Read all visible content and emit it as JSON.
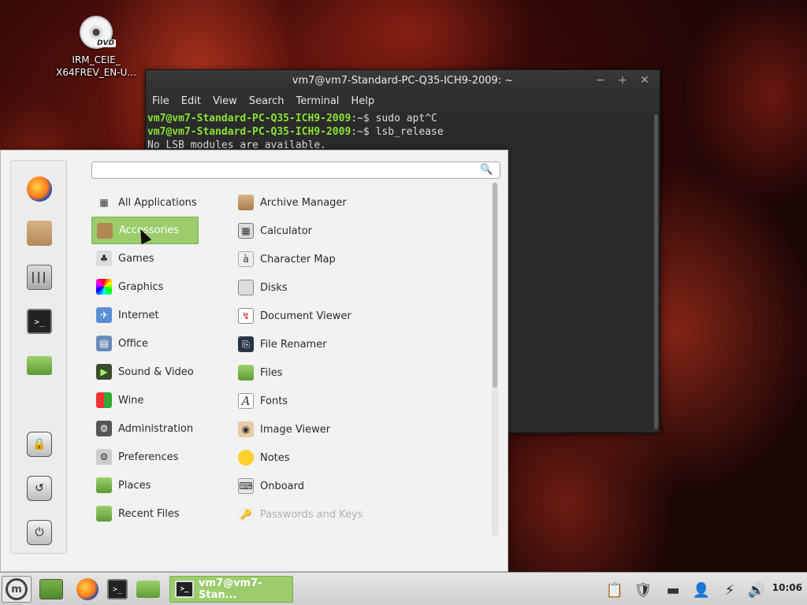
{
  "desktop": {
    "icon": {
      "badge": "DVD",
      "label_line1": "IRM_CEIE_",
      "label_line2": "X64FREV_EN-U..."
    }
  },
  "terminal": {
    "title": "vm7@vm7-Standard-PC-Q35-ICH9-2009: ~",
    "menu": [
      "File",
      "Edit",
      "View",
      "Search",
      "Terminal",
      "Help"
    ],
    "lines": [
      {
        "prompt": "vm7@vm7-Standard-PC-Q35-ICH9-2009",
        "path": ":~$ ",
        "cmd": "sudo apt^C"
      },
      {
        "prompt": "vm7@vm7-Standard-PC-Q35-ICH9-2009",
        "path": ":~$ ",
        "cmd": "lsb_release"
      },
      {
        "prompt": "",
        "path": "",
        "cmd": "No LSB modules are available."
      }
    ]
  },
  "menu": {
    "search_value": "",
    "categories": [
      {
        "label": "All Applications",
        "icon": "grid-icon"
      },
      {
        "label": "Accessories",
        "icon": "accessories-icon",
        "active": true
      },
      {
        "label": "Games",
        "icon": "games-icon"
      },
      {
        "label": "Graphics",
        "icon": "graphics-icon"
      },
      {
        "label": "Internet",
        "icon": "internet-icon"
      },
      {
        "label": "Office",
        "icon": "office-icon"
      },
      {
        "label": "Sound & Video",
        "icon": "sound-video-icon"
      },
      {
        "label": "Wine",
        "icon": "wine-icon"
      },
      {
        "label": "Administration",
        "icon": "administration-icon"
      },
      {
        "label": "Preferences",
        "icon": "preferences-icon"
      },
      {
        "label": "Places",
        "icon": "places-icon"
      },
      {
        "label": "Recent Files",
        "icon": "recent-files-icon"
      }
    ],
    "apps": [
      {
        "label": "Archive Manager",
        "icon": "archive-icon"
      },
      {
        "label": "Calculator",
        "icon": "calculator-icon"
      },
      {
        "label": "Character Map",
        "icon": "character-map-icon"
      },
      {
        "label": "Disks",
        "icon": "disks-icon"
      },
      {
        "label": "Document Viewer",
        "icon": "document-viewer-icon"
      },
      {
        "label": "File Renamer",
        "icon": "file-renamer-icon"
      },
      {
        "label": "Files",
        "icon": "folder-icon"
      },
      {
        "label": "Fonts",
        "icon": "fonts-icon"
      },
      {
        "label": "Image Viewer",
        "icon": "image-viewer-icon"
      },
      {
        "label": "Notes",
        "icon": "notes-icon"
      },
      {
        "label": "Onboard",
        "icon": "onboard-icon"
      },
      {
        "label": "Passwords and Keys",
        "icon": "passwords-icon",
        "disabled": true
      }
    ]
  },
  "taskbar": {
    "window_label": "vm7@vm7-Stan...",
    "clock": "10:06"
  },
  "colors": {
    "accent": "#9ccc6c",
    "prompt": "#8ae234"
  }
}
